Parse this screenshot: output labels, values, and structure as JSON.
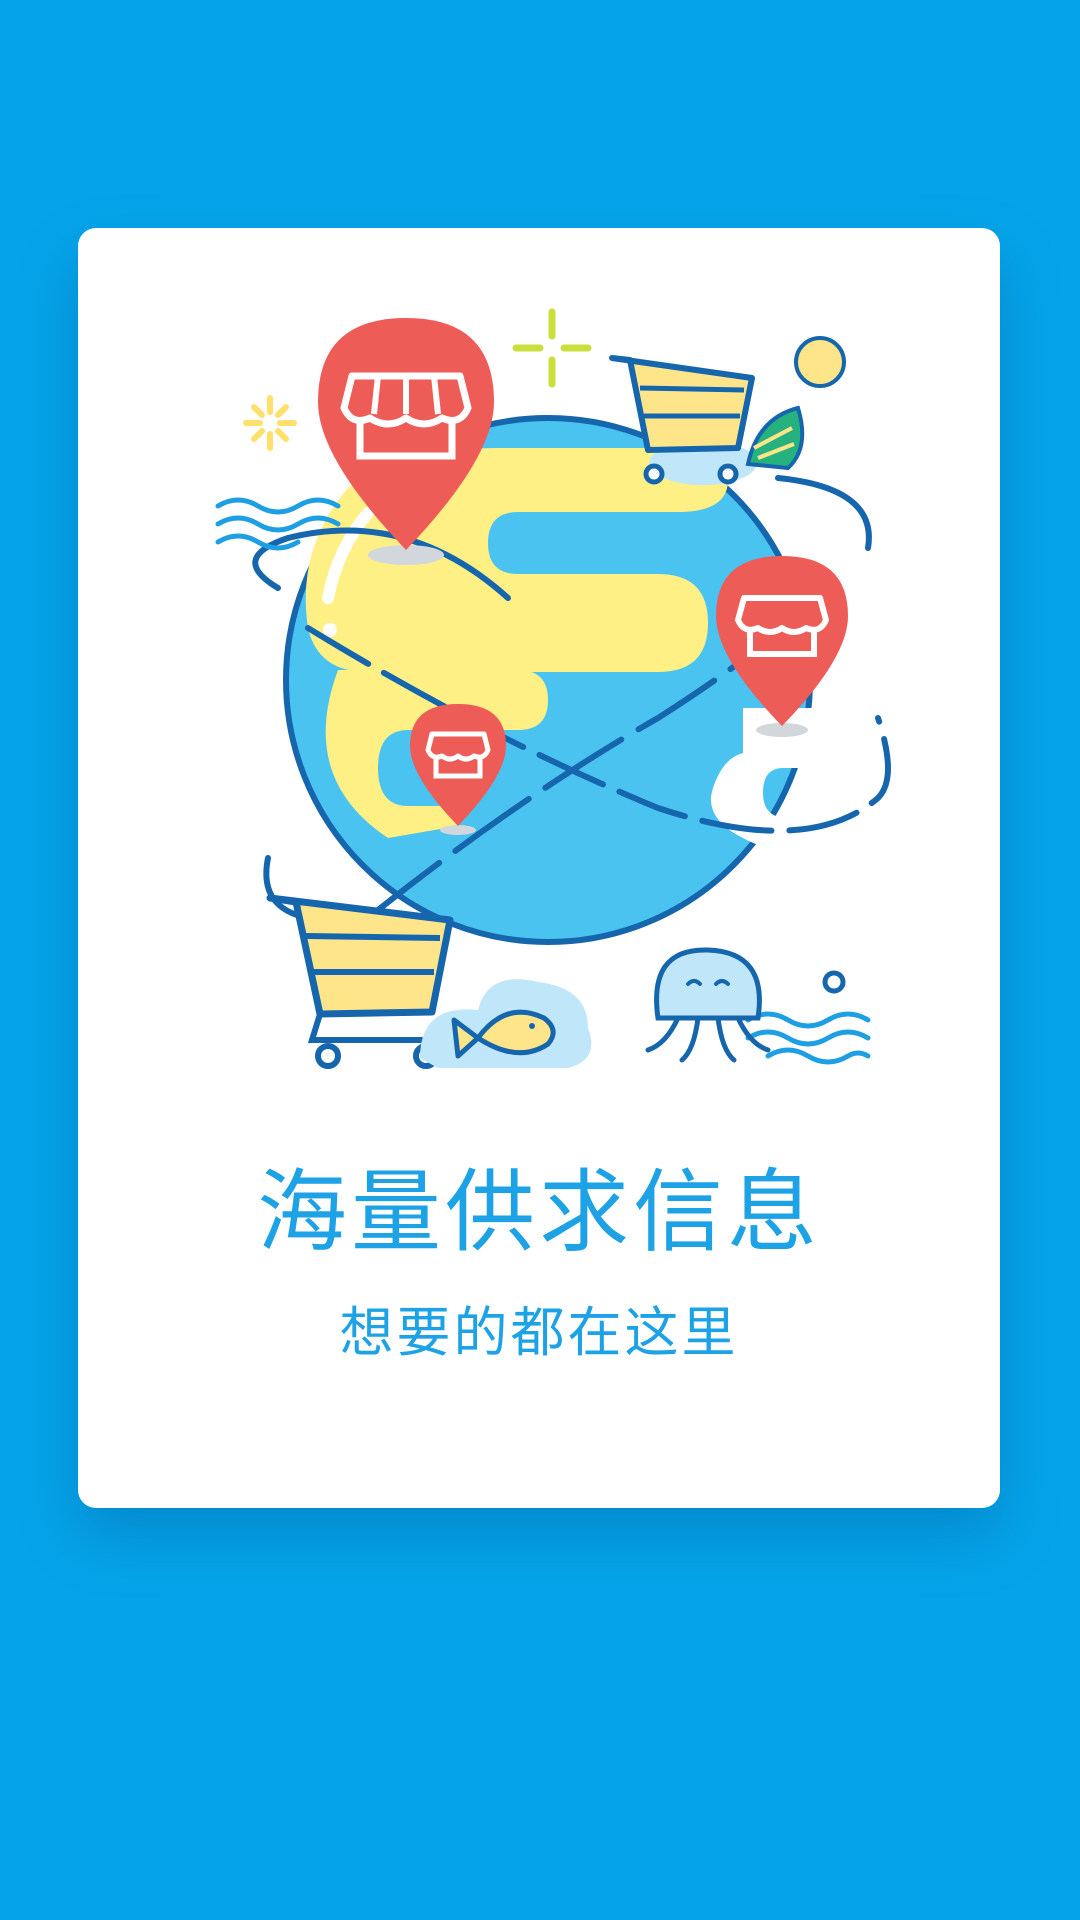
{
  "onboarding": {
    "headline": "海量供求信息",
    "subline": "想要的都在这里"
  },
  "theme": {
    "background": "#05a4ea",
    "card": "#ffffff",
    "accent_text": "#1ea2e6",
    "globe": "#4ac3f1",
    "pin": "#ee5c58",
    "cart": "#ffe58a"
  },
  "illustration": {
    "icons": [
      "globe-icon",
      "location-pin-shop-icon",
      "shopping-cart-icon",
      "fish-icon",
      "octopus-icon",
      "sun-icon",
      "wave-icon",
      "sparkle-icon"
    ]
  }
}
